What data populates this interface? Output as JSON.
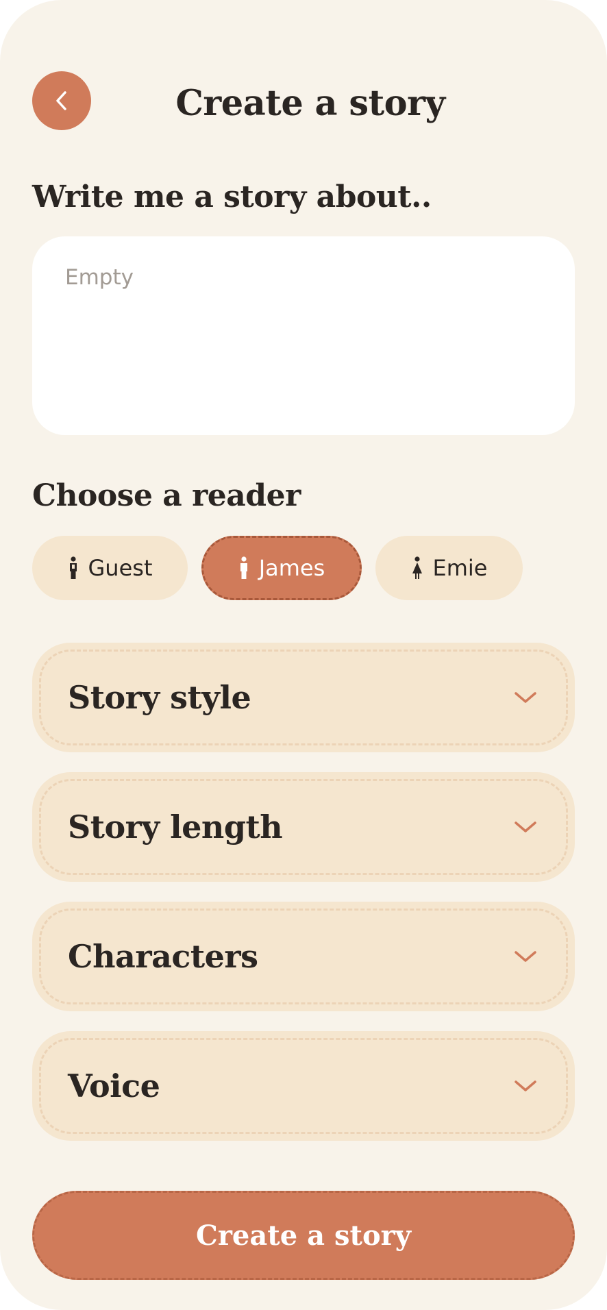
{
  "header": {
    "title": "Create a story",
    "back_icon": "chevron-left-icon"
  },
  "prompt": {
    "label": "Write me a story about..",
    "value": "",
    "placeholder": "Empty"
  },
  "reader": {
    "label": "Choose a reader",
    "options": [
      {
        "name": "Guest",
        "icon": "person-icon",
        "selected": false
      },
      {
        "name": "James",
        "icon": "person-icon",
        "selected": true
      },
      {
        "name": "Emie",
        "icon": "person-dress-icon",
        "selected": false
      }
    ]
  },
  "sections": [
    {
      "label": "Story style",
      "icon": "chevron-down-icon"
    },
    {
      "label": "Story length",
      "icon": "chevron-down-icon"
    },
    {
      "label": "Characters",
      "icon": "chevron-down-icon"
    },
    {
      "label": "Voice",
      "icon": "chevron-down-icon"
    }
  ],
  "create_button": {
    "label": "Create a story"
  },
  "colors": {
    "background": "#f8f3ea",
    "accent": "#d07b5a",
    "pill": "#f5e6cf",
    "text": "#2a2522"
  }
}
